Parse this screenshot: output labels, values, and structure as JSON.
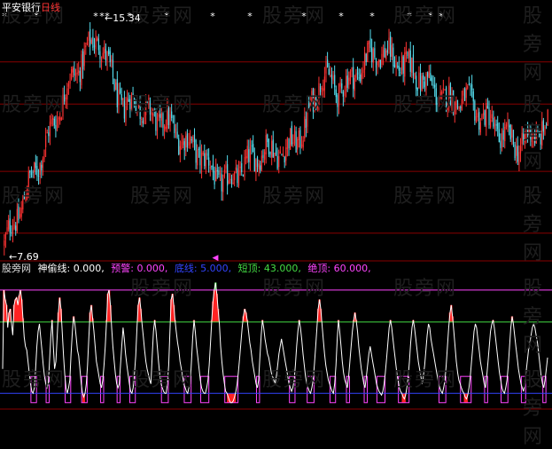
{
  "header": {
    "stock_name": "平安银行",
    "period": "日线",
    "colors": {
      "stock_name": "#ffffff",
      "period": "#ff3333"
    }
  },
  "watermark": "股旁网",
  "indicator_header": {
    "source": "股旁网",
    "items": [
      {
        "label": "神偷线:",
        "value": "0.000,",
        "color": "#ffffff"
      },
      {
        "label": "预警:",
        "value": "0.000,",
        "color": "#ff44ff"
      },
      {
        "label": "底线:",
        "value": "5.000,",
        "color": "#3344ff"
      },
      {
        "label": "短顶:",
        "value": "43.000,",
        "color": "#44dd44"
      },
      {
        "label": "绝顶:",
        "value": "60.000,",
        "color": "#ff44ff"
      }
    ]
  },
  "chart_data": [
    {
      "type": "candlestick",
      "max_label": "15.34",
      "min_label": "7.69",
      "ylim": [
        7.3,
        15.9
      ],
      "gridlines": [
        8.1,
        10.3,
        12.7,
        14.2
      ],
      "colors": {
        "up": "#ff3333",
        "down": "#55ddee",
        "grid": "#880000",
        "marker": "#ffffff",
        "arrow": "#ff44ff"
      },
      "markers": [
        0,
        8,
        9,
        28,
        37,
        47,
        66,
        75,
        86,
        93,
        97
      ]
    },
    {
      "type": "line",
      "ylim": [
        -2,
        68
      ],
      "levels": [
        {
          "name": "绝顶",
          "value": 60,
          "color": "#ff44ff"
        },
        {
          "name": "短顶",
          "value": 43,
          "color": "#44dd44"
        },
        {
          "name": "底线",
          "value": 5,
          "color": "#3344ff"
        }
      ],
      "series": [
        {
          "name": "神偷线",
          "color": "#ffffff",
          "values": [
            18,
            60,
            55,
            52,
            40,
            48,
            50,
            42,
            36,
            52,
            55,
            56,
            52,
            57,
            60,
            55,
            45,
            35,
            30,
            28,
            22,
            16,
            10,
            6,
            5,
            8,
            18,
            30,
            38,
            42,
            35,
            28,
            20,
            14,
            10,
            8,
            10,
            22,
            35,
            44,
            30,
            18,
            22,
            35,
            48,
            56,
            50,
            38,
            25,
            15,
            8,
            5,
            8,
            12,
            26,
            38,
            46,
            42,
            35,
            28,
            25,
            18,
            10,
            5,
            3,
            5,
            10,
            20,
            35,
            48,
            52,
            45,
            38,
            30,
            22,
            18,
            14,
            10,
            8,
            12,
            20,
            30,
            44,
            58,
            60,
            52,
            40,
            30,
            22,
            15,
            10,
            8,
            10,
            20,
            30,
            40,
            34,
            26,
            20,
            15,
            10,
            6,
            5,
            8,
            15,
            25,
            40,
            52,
            56,
            50,
            42,
            35,
            28,
            22,
            18,
            15,
            12,
            10,
            25,
            38,
            44,
            38,
            30,
            22,
            15,
            10,
            8,
            6,
            5,
            5,
            10,
            20,
            38,
            55,
            58,
            52,
            44,
            38,
            32,
            28,
            22,
            18,
            14,
            10,
            8,
            6,
            5,
            8,
            10,
            22,
            35,
            44,
            38,
            30,
            24,
            18,
            12,
            8,
            6,
            5,
            5,
            8,
            12,
            20,
            32,
            44,
            54,
            60,
            64,
            58,
            50,
            42,
            30,
            22,
            15,
            10,
            6,
            5,
            3,
            1,
            0,
            0,
            1,
            3,
            6,
            10,
            16,
            24,
            32,
            40,
            46,
            50,
            48,
            44,
            38,
            32,
            28,
            22,
            18,
            14,
            10,
            8,
            12,
            24,
            36,
            44,
            40,
            34,
            30,
            26,
            24,
            20,
            16,
            14,
            12,
            10,
            14,
            20,
            26,
            30,
            34,
            30,
            26,
            22,
            18,
            14,
            10,
            8,
            6,
            8,
            12,
            20,
            30,
            38,
            44,
            40,
            34,
            26,
            20,
            14,
            10,
            8,
            6,
            5,
            8,
            12,
            20,
            30,
            40,
            50,
            55,
            50,
            42,
            34,
            26,
            20,
            16,
            12,
            10,
            8,
            6,
            5,
            10,
            20,
            34,
            44,
            38,
            30,
            22,
            16,
            12,
            10,
            8,
            14,
            22,
            30,
            38,
            44,
            48,
            44,
            38,
            30,
            24,
            18,
            14,
            10,
            8,
            14,
            20,
            26,
            30,
            26,
            22,
            18,
            14,
            10,
            8,
            6,
            5,
            4,
            6,
            10,
            16,
            24,
            32,
            40,
            44,
            40,
            34,
            28,
            22,
            16,
            12,
            8,
            6,
            5,
            3,
            2,
            4,
            8,
            14,
            22,
            32,
            40,
            44,
            40,
            34,
            28,
            22,
            18,
            14,
            10,
            14,
            20,
            28,
            36,
            42,
            40,
            34,
            30,
            26,
            22,
            18,
            14,
            10,
            8,
            6,
            5,
            8,
            12,
            20,
            30,
            40,
            48,
            52,
            46,
            38,
            30,
            22,
            16,
            12,
            10,
            8,
            6,
            5,
            3,
            2,
            4,
            8,
            14,
            22,
            30,
            38,
            42,
            40,
            34,
            28,
            22,
            18,
            14,
            10,
            8,
            14,
            22,
            30,
            38,
            42,
            44,
            40,
            34,
            28,
            22,
            16,
            12,
            8,
            6,
            5,
            8,
            12,
            20,
            30,
            40,
            46,
            42,
            36,
            30,
            24,
            18,
            14,
            10,
            8,
            6,
            10,
            16,
            22,
            28,
            32,
            36,
            40,
            42,
            40,
            36,
            32,
            26,
            20,
            14,
            10,
            8,
            12,
            18,
            24
          ]
        }
      ],
      "alert_color": "#ff44ff",
      "peak_red": "#ff2222",
      "peak_green": "#22dd22",
      "bottom_fill": "#ff2222"
    }
  ]
}
